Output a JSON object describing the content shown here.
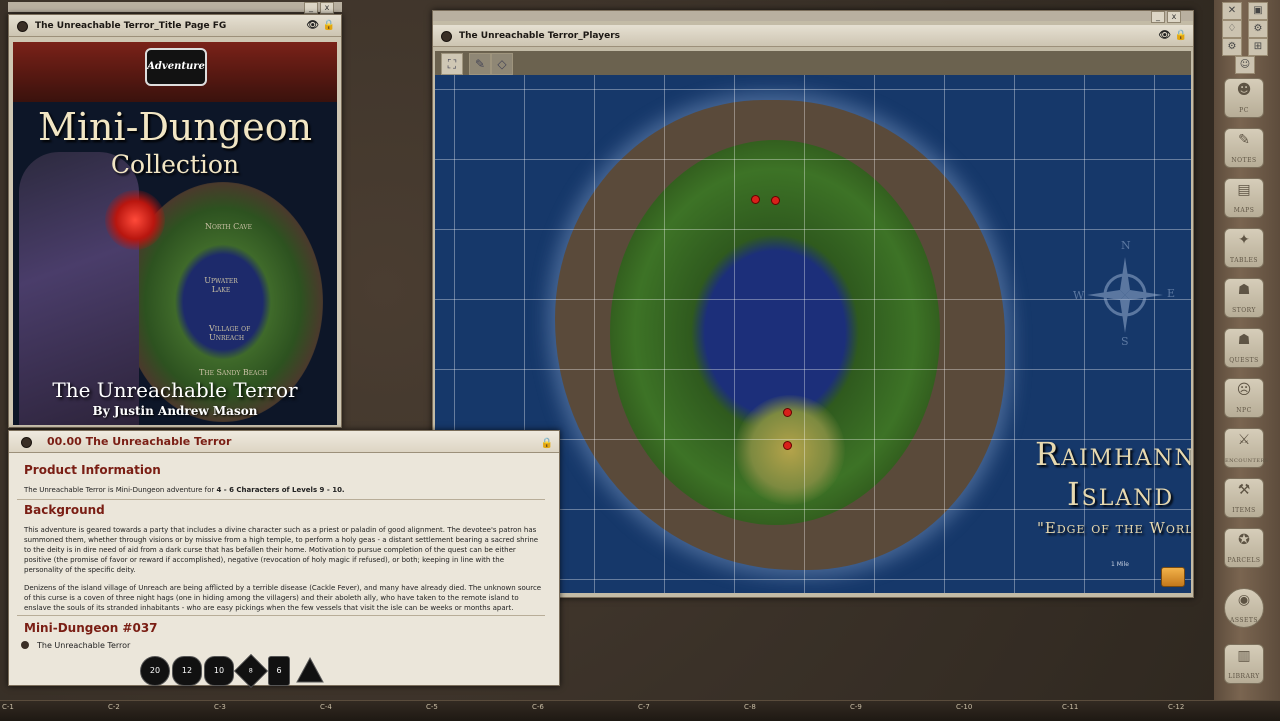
{
  "cover_window": {
    "title": "The Unreachable Terror_Title Page FG",
    "logo": "Adventure",
    "heading": "Mini-Dungeon",
    "subheading": "Collection",
    "labels": [
      "North Cave",
      "Upwater Lake",
      "Village of Unreach",
      "The Sandy Beach"
    ],
    "book_title": "The Unreachable Terror",
    "author": "By Justin Andrew Mason"
  },
  "map_window": {
    "title": "The Unreachable Terror_Players",
    "tools": [
      "select-icon",
      "pencil-icon",
      "eraser-icon"
    ],
    "map_title_1": "Raimhann",
    "map_title_2": "Island",
    "map_subtitle": "\"Edge of the World\"",
    "compass": {
      "n": "N",
      "e": "E",
      "s": "S",
      "w": "W"
    },
    "scale_label": "1 Mile"
  },
  "story_window": {
    "title": "00.00 The Unreachable Terror",
    "h_product": "Product Information",
    "p_product_prefix": "The Unreachable Terror is Mini-Dungeon adventure for ",
    "p_product_bold": "4 - 6 Characters of Levels 9 - 10.",
    "h_background": "Background",
    "p_background_1": "This adventure is geared towards a party that includes a divine character such as a priest or paladin of good alignment. The devotee's patron has summoned them, whether through visions or by missive from a high temple, to perform a holy geas - a distant settlement bearing a sacred shrine to the deity is in dire need of aid from a dark curse that has befallen their home. Motivation to pursue completion of the quest can be either positive (the promise of favor or reward if accomplished), negative (revocation of holy magic if refused), or both; keeping in line with the personality of the specific deity.",
    "p_background_2": "Denizens of the island village of Unreach are being afflicted by a terrible disease (Cackle Fever), and many have already died. The unknown source of this curse is a coven of three night hags (one in hiding among the villagers) and their aboleth ally, who have taken to the remote island to enslave the souls of its stranded inhabitants - who are easy pickings when the few vessels that visit the isle can be weeks or months apart.",
    "h_mini": "Mini-Dungeon #037",
    "link": "The Unreachable Terror"
  },
  "dice": [
    "20",
    "12",
    "10",
    "8",
    "6",
    "4"
  ],
  "sidebar": {
    "items": [
      "PC",
      "NOTES",
      "MAPS",
      "TABLES",
      "STORY",
      "QUESTS",
      "NPC",
      "ENCOUNTERS",
      "ITEMS",
      "PARCELS",
      "ASSETS",
      "LIBRARY"
    ]
  },
  "bottom": {
    "marks": [
      "C-1",
      "C-2",
      "C-3",
      "C-4",
      "C-5",
      "C-6",
      "C-7",
      "C-8",
      "C-9",
      "C-10",
      "C-11",
      "C-12"
    ]
  },
  "colors": {
    "heading_red": "#7a1e14",
    "sea_blue": "#16386a",
    "forest_green": "#3d7326",
    "parchment": "#ebe6da"
  }
}
